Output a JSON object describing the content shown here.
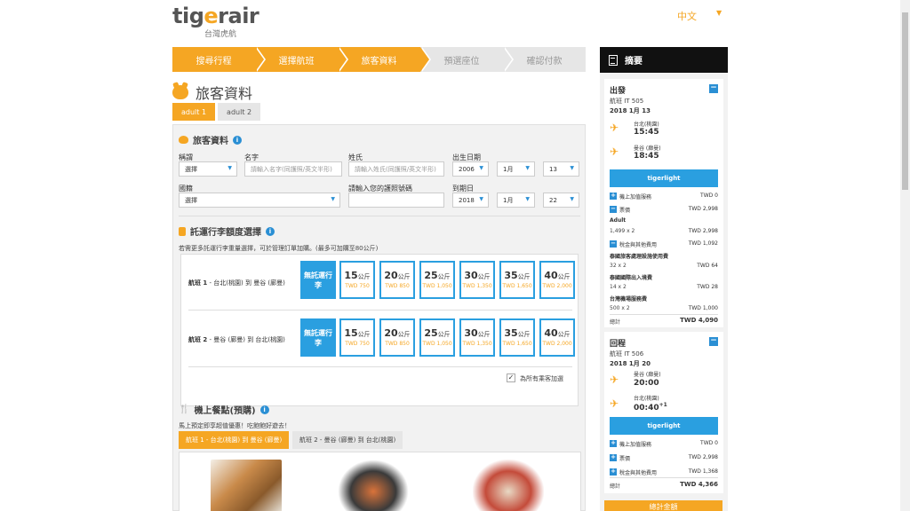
{
  "header": {
    "brand": "tigerair",
    "brand_sub": "台灣虎航",
    "language": "中文"
  },
  "steps": [
    "搜尋行程",
    "選擇航班",
    "旅客資料",
    "預選座位",
    "確認付款"
  ],
  "page_title": "旅客資料",
  "pax_tabs": [
    "adult 1",
    "adult 2"
  ],
  "passenger": {
    "title": "旅客資料",
    "labels": {
      "salutation": "稱謂",
      "first_name": "名字",
      "last_name": "姓氏",
      "dob": "出生日期",
      "nationality": "國籍",
      "passport": "請輸入您的護照號碼",
      "expiry": "到期日"
    },
    "salutation_value": "選擇",
    "first_name_placeholder": "請輸入名字(同護照/英文半形)",
    "last_name_placeholder": "請輸入姓氏(同護照/英文半形)",
    "dob": {
      "year": "2006",
      "month": "1月",
      "day": "13"
    },
    "nationality_value": "選擇",
    "expiry": {
      "year": "2018",
      "month": "1月",
      "day": "22"
    }
  },
  "baggage": {
    "title": "託運行李額度選擇",
    "note": "若需更多託運行李重量選擇，可於管理訂單加購。(最多可加購至80公斤)",
    "unit": "公斤",
    "no_bag": "無託運行李",
    "flights": [
      {
        "label": "航班 1",
        "route": " - 台北(桃園) 到 曼谷 (廊曼)"
      },
      {
        "label": "航班 2",
        "route": " - 曼谷 (廊曼) 到 台北(桃園)"
      }
    ],
    "options": [
      {
        "kg": "15",
        "price": "TWD 750"
      },
      {
        "kg": "20",
        "price": "TWD 850"
      },
      {
        "kg": "25",
        "price": "TWD 1,050"
      },
      {
        "kg": "30",
        "price": "TWD 1,350"
      },
      {
        "kg": "35",
        "price": "TWD 1,650"
      },
      {
        "kg": "40",
        "price": "TWD 2,000"
      }
    ],
    "apply_all": "為所有乘客加選"
  },
  "meals": {
    "title": "機上餐點(預購)",
    "note": "馬上預定即享超值優惠！吃飽飽好遊去！",
    "tabs": [
      "航班 1 - 台北(桃園) 到 曼谷 (廊曼)",
      "航班 2 - 曼谷 (廊曼) 到 台北(桃園)"
    ]
  },
  "summary": {
    "title": "摘要",
    "outbound": {
      "title": "出發",
      "flight": "航班 IT 505",
      "date": "2018 1月 13",
      "from_city": "台北(桃園)",
      "from_time": "15:45",
      "to_city": "曼谷 (廊曼)",
      "to_time": "18:45",
      "fare_name": "tigerlight",
      "addon_label": "機上加值服務",
      "addon_price": "TWD 0",
      "fare_label": "票價",
      "fare_price": "TWD 2,998",
      "pax_type": "Adult",
      "pax_calc": "1,499 x 2",
      "pax_price": "TWD 2,998",
      "tax_label": "稅金與其他費用",
      "tax_price": "TWD 1,092",
      "tax1_name": "泰國旅客處理設施使用費",
      "tax1_calc": "32 x 2",
      "tax1_price": "TWD 64",
      "tax2_name": "泰國國際出入境費",
      "tax2_calc": "14 x 2",
      "tax2_price": "TWD 28",
      "tax3_name": "台灣機場服務費",
      "tax3_calc": "500 x 2",
      "tax3_price": "TWD 1,000",
      "total_label": "總計",
      "total": "TWD 4,090"
    },
    "inbound": {
      "title": "回程",
      "flight": "航班 IT 506",
      "date": "2018 1月 20",
      "from_city": "曼谷 (廊曼)",
      "from_time": "20:00",
      "to_city": "台北(桃園)",
      "to_time": "00:40",
      "to_time_sup": "+1",
      "fare_name": "tigerlight",
      "addon_label": "機上加值服務",
      "addon_price": "TWD 0",
      "fare_label": "票價",
      "fare_price": "TWD 2,998",
      "tax_label": "稅金與其他費用",
      "tax_price": "TWD 1,368",
      "total_label": "總計",
      "total": "TWD 4,366"
    },
    "grand_total_label": "總計金額"
  },
  "colors": {
    "accent": "#f5a623",
    "blue": "#2a9fe0",
    "dark": "#111111"
  }
}
